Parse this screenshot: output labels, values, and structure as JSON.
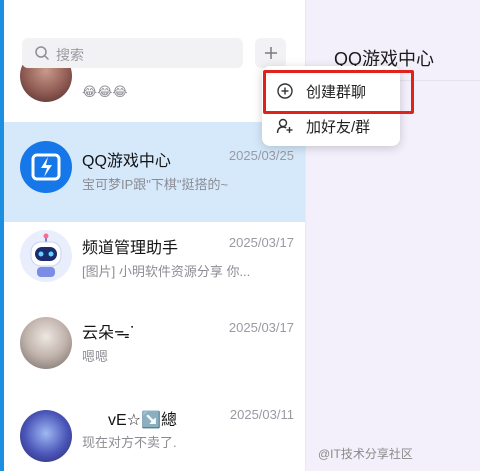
{
  "search": {
    "placeholder": "搜索"
  },
  "header": {
    "chat_title": "QQ游戏中心"
  },
  "chats": [
    {
      "name": "",
      "date": "",
      "preview": "😂😂😂"
    },
    {
      "name": "QQ游戏中心",
      "date": "2025/03/25",
      "preview": "宝可梦IP跟\"下棋\"挺搭的~"
    },
    {
      "name": "频道管理助手",
      "date": "2025/03/17",
      "preview": "[图片] 小明软件资源分享 你..."
    },
    {
      "name": "云朵ᯓᐝ",
      "date": "2025/03/17",
      "preview": "嗯嗯"
    },
    {
      "name": "vE☆↘️總",
      "date": "2025/03/11",
      "preview": "现在对方不卖了."
    }
  ],
  "menu": {
    "items": [
      {
        "label": "创建群聊",
        "icon": "create-group-icon"
      },
      {
        "label": "加好友/群",
        "icon": "add-friend-icon"
      }
    ]
  },
  "watermark": "@IT技术分享社区",
  "colors": {
    "accent": "#1d8fe0",
    "selected": "#d5e9fb",
    "highlight": "#e0221c"
  }
}
